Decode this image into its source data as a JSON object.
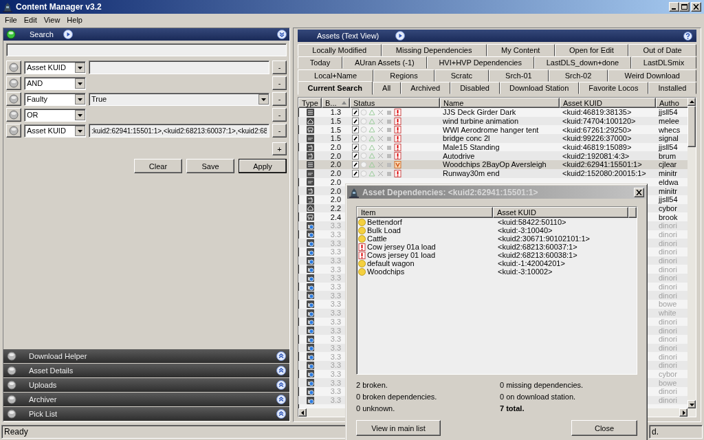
{
  "window": {
    "title": "Content Manager v3.2"
  },
  "menu": [
    "File",
    "Edit",
    "View",
    "Help"
  ],
  "search_panel": {
    "title": "Search",
    "expanded": true,
    "conditions": [
      {
        "kind": "criterion",
        "field": "Asset KUID",
        "value_field": {
          "kind": "text"
        },
        "remove_button": "-"
      },
      {
        "kind": "operator",
        "field": "AND",
        "remove_button": "-"
      },
      {
        "kind": "criterion",
        "field": "Faulty",
        "value_field": {
          "kind": "choice",
          "value": "True"
        },
        "remove_button": "-"
      },
      {
        "kind": "operator",
        "field": "OR",
        "remove_button": "-"
      },
      {
        "kind": "criterion",
        "field": "Asset KUID",
        "value_field": {
          "kind": "text",
          "value": ":kuid2:62941:15501:1>,<kuid2:68213:60037:1>,<kuid2:68"
        },
        "remove_button": "-"
      }
    ],
    "add_button": "+",
    "buttons": [
      "Clear",
      "Save",
      "Apply"
    ]
  },
  "collapsed_panels": [
    {
      "title": "Download Helper",
      "expanded": false
    },
    {
      "title": "Asset Details",
      "expanded": false
    },
    {
      "title": "Uploads",
      "expanded": false
    },
    {
      "title": "Archiver",
      "expanded": false
    },
    {
      "title": "Pick List",
      "expanded": false
    }
  ],
  "assets_panel": {
    "title": "Assets (Text View)",
    "tab_rows": [
      [
        {
          "label": "Locally Modified",
          "selected": false
        },
        {
          "label": "Missing Dependencies",
          "selected": false
        },
        {
          "label": "My Content",
          "selected": false
        },
        {
          "label": "Open for Edit",
          "selected": false
        },
        {
          "label": "Out of Date",
          "selected": false
        }
      ],
      [
        {
          "label": "Today",
          "selected": false
        },
        {
          "label": "AUran Assets (-1)",
          "selected": false
        },
        {
          "label": "HVI+HVP Dependencies",
          "selected": false
        },
        {
          "label": "LastDLS_down+done",
          "selected": false
        },
        {
          "label": "LastDLSmix",
          "selected": false
        }
      ],
      [
        {
          "label": "Local+Name",
          "selected": false
        },
        {
          "label": "Regions",
          "selected": false
        },
        {
          "label": "Scratc",
          "selected": false
        },
        {
          "label": "Srch-01",
          "selected": false
        },
        {
          "label": "Srch-02",
          "selected": false
        },
        {
          "label": "Weird Download",
          "selected": false
        }
      ],
      [
        {
          "label": "Current Search",
          "selected": true
        },
        {
          "label": "All",
          "selected": false
        },
        {
          "label": "Archived",
          "selected": false
        },
        {
          "label": "Disabled",
          "selected": false
        },
        {
          "label": "Download Station",
          "selected": false
        },
        {
          "label": "Favorite Locos",
          "selected": false
        },
        {
          "label": "Installed",
          "selected": false
        }
      ]
    ],
    "table": {
      "columns": [
        "Type",
        "B...",
        "Status",
        "Name",
        "Asset KUID",
        "Autho"
      ],
      "rows": [
        {
          "kind": "bars",
          "build": "1.3",
          "status": {
            "kind": "faulty"
          },
          "name": "JJS Deck Girder Dark",
          "kuid": "<kuid:46819:38135>",
          "author": "jjsll54",
          "selected": false,
          "disabled": false
        },
        {
          "kind": "house",
          "build": "1.5",
          "status": {
            "kind": "faulty"
          },
          "name": "wind turbine animation",
          "kuid": "<kuid:74704:100120>",
          "author": "melee",
          "selected": false,
          "disabled": false
        },
        {
          "kind": "car",
          "build": "1.5",
          "status": {
            "kind": "faulty"
          },
          "name": "WWI Aerodrome hanger tent",
          "kuid": "<kuid:67261:29250>",
          "author": "whecs",
          "selected": false,
          "disabled": false
        },
        {
          "kind": "tag",
          "build": "1.5",
          "status": {
            "kind": "faulty"
          },
          "name": "bridge conc 2l",
          "kuid": "<kuid:99226:37000>",
          "author": "signal",
          "selected": false,
          "disabled": false
        },
        {
          "kind": "arrow",
          "build": "2.0",
          "status": {
            "kind": "faulty"
          },
          "name": "Male15 Standing",
          "kuid": "<kuid:46819:15089>",
          "author": "jjsll54",
          "selected": false,
          "disabled": false
        },
        {
          "kind": "arrow",
          "build": "2.0",
          "status": {
            "kind": "faulty"
          },
          "name": "Autodrive",
          "kuid": "<kuid2:192081:4:3>",
          "author": "brum",
          "selected": false,
          "disabled": false
        },
        {
          "kind": "bars",
          "build": "2.0",
          "status": {
            "kind": "warning"
          },
          "name": "Woodchips 2BayOp Aversleigh",
          "kuid": "<kuid2:62941:15501:1>",
          "author": "cjlear",
          "selected": true,
          "disabled": false
        },
        {
          "kind": "tag",
          "build": "2.0",
          "status": {
            "kind": "faulty"
          },
          "name": "Runway30m end",
          "kuid": "<kuid2:152080:20015:1>",
          "author": "minitr",
          "selected": false,
          "disabled": false
        },
        {
          "kind": "tag",
          "build": "2.0",
          "author": "eldwa",
          "selected": false,
          "disabled": false
        },
        {
          "kind": "arrow",
          "build": "2.0",
          "author": "minitr",
          "selected": false,
          "disabled": false
        },
        {
          "kind": "arrow",
          "build": "2.0",
          "author": "jjsll54",
          "selected": false,
          "disabled": false
        },
        {
          "kind": "house",
          "build": "2.2",
          "author": "cybor",
          "selected": false,
          "disabled": false
        },
        {
          "kind": "car",
          "build": "2.4",
          "author": "brook",
          "selected": false,
          "disabled": false
        },
        {
          "kind": "globe",
          "build": "3.3",
          "author": "dinori",
          "selected": false,
          "disabled": true
        },
        {
          "kind": "globe",
          "build": "3.3",
          "author": "dinori",
          "selected": false,
          "disabled": true
        },
        {
          "kind": "globe",
          "build": "3.3",
          "author": "dinori",
          "selected": false,
          "disabled": true
        },
        {
          "kind": "globe",
          "build": "3.3",
          "author": "dinori",
          "selected": false,
          "disabled": true
        },
        {
          "kind": "globe",
          "build": "3.3",
          "author": "dinori",
          "selected": false,
          "disabled": true
        },
        {
          "kind": "globe",
          "build": "3.3",
          "author": "dinori",
          "selected": false,
          "disabled": true
        },
        {
          "kind": "globe",
          "build": "3.3",
          "author": "dinori",
          "selected": false,
          "disabled": true
        },
        {
          "kind": "globe",
          "build": "3.3",
          "author": "dinori",
          "selected": false,
          "disabled": true
        },
        {
          "kind": "globe",
          "build": "3.3",
          "author": "dinori",
          "selected": false,
          "disabled": true
        },
        {
          "kind": "globe",
          "build": "3.3",
          "author": "bowe",
          "selected": false,
          "disabled": true
        },
        {
          "kind": "globe",
          "build": "3.3",
          "author": "white",
          "selected": false,
          "disabled": true
        },
        {
          "kind": "globe",
          "build": "3.3",
          "author": "dinori",
          "selected": false,
          "disabled": true
        },
        {
          "kind": "globe",
          "build": "3.3",
          "author": "dinori",
          "selected": false,
          "disabled": true
        },
        {
          "kind": "globe",
          "build": "3.3",
          "author": "dinori",
          "selected": false,
          "disabled": true
        },
        {
          "kind": "globe",
          "build": "3.3",
          "author": "dinori",
          "selected": false,
          "disabled": true
        },
        {
          "kind": "globe",
          "build": "3.3",
          "author": "dinori",
          "selected": false,
          "disabled": true
        },
        {
          "kind": "globe",
          "build": "3.3",
          "author": "dinori",
          "selected": false,
          "disabled": true
        },
        {
          "kind": "globe",
          "build": "3.3",
          "author": "cybor",
          "selected": false,
          "disabled": true
        },
        {
          "kind": "globe",
          "build": "3.3",
          "author": "bowe",
          "selected": false,
          "disabled": true
        },
        {
          "kind": "globe",
          "build": "3.3",
          "author": "dinori",
          "selected": false,
          "disabled": true
        },
        {
          "kind": "globe",
          "build": "3.3",
          "author": "dinori",
          "selected": false,
          "disabled": true
        }
      ]
    }
  },
  "status_bar": {
    "text": "Ready",
    "right_text": "d."
  },
  "dialog": {
    "title": "Asset Dependencies: <kuid2:62941:15501:1>",
    "columns": [
      "Item",
      "Asset KUID"
    ],
    "items": [
      {
        "kind": "ok",
        "name": "Bettendorf",
        "kuid": "<kuid:58422:50110>"
      },
      {
        "kind": "ok",
        "name": "Bulk Load",
        "kuid": "<kuid:-3:10040>"
      },
      {
        "kind": "ok",
        "name": "Cattle",
        "kuid": "<kuid2:30671:90102101:1>"
      },
      {
        "kind": "broken",
        "name": "Cow jersey 01a load",
        "kuid": "<kuid2:68213:60037:1>"
      },
      {
        "kind": "broken",
        "name": "Cows jersey 01 load",
        "kuid": "<kuid2:68213:60038:1>"
      },
      {
        "kind": "ok",
        "name": "default wagon",
        "kuid": "<kuid:-1:42004201>"
      },
      {
        "kind": "ok",
        "name": "Woodchips",
        "kuid": "<kuid:-3:10002>"
      }
    ],
    "summary": [
      {
        "text": "2 broken.",
        "emphasis": false
      },
      {
        "text": "0 missing dependencies.",
        "emphasis": false
      },
      {
        "text": "0 broken dependencies.",
        "emphasis": false
      },
      {
        "text": "0 on download station.",
        "emphasis": false
      },
      {
        "text": "0 unknown.",
        "emphasis": false
      },
      {
        "text": "7 total.",
        "emphasis": true
      }
    ],
    "buttons": [
      "View in main list",
      "Close"
    ]
  }
}
